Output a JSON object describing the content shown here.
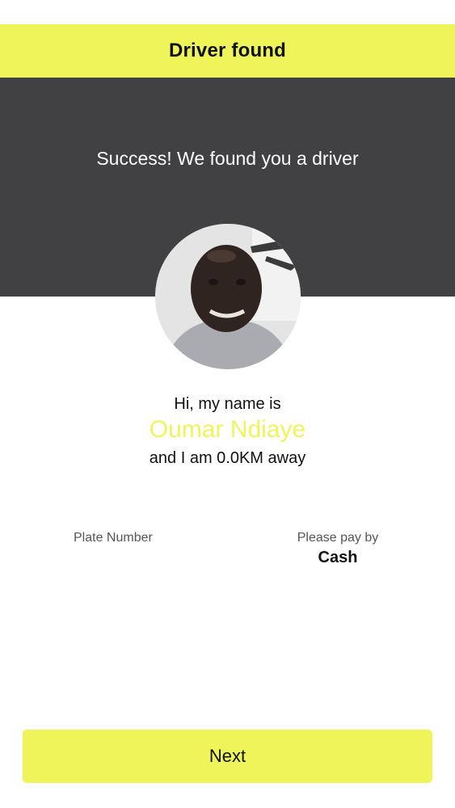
{
  "header": {
    "title": "Driver found"
  },
  "hero": {
    "message": "Success! We found you a driver"
  },
  "driver": {
    "avatar_icon": "driver-photo",
    "greeting": "Hi, my name is",
    "name": "Oumar Ndiaye",
    "distance_text": "and I am 0.0KM away"
  },
  "details": {
    "plate_label": "Plate Number",
    "plate_value": "",
    "payment_label": "Please pay by",
    "payment_value": "Cash"
  },
  "actions": {
    "next_label": "Next"
  },
  "colors": {
    "accent": "#eff458",
    "hero_background": "#414042",
    "text": "#111111"
  }
}
